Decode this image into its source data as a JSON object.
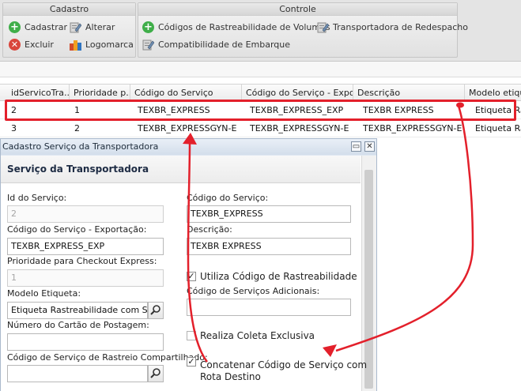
{
  "ribbon": {
    "cadastro": {
      "title": "Cadastro",
      "cadastrar": "Cadastrar",
      "alterar": "Alterar",
      "excluir": "Excluir",
      "logomarca": "Logomarca"
    },
    "controle": {
      "title": "Controle",
      "codigos_rastreabilidade": "Códigos de Rastreabilidade de Volumes",
      "transportadora_redespacho": "Transportadora de Redespacho",
      "compatibilidade_embarque": "Compatibilidade de Embarque"
    }
  },
  "grid": {
    "columns": [
      "idServicoTra...",
      "Prioridade p...",
      "Código do Serviço",
      "Código do Serviço - Expo...",
      "Descrição",
      "Modelo etique"
    ],
    "rows": [
      [
        "2",
        "1",
        "TEXBR_EXPRESS",
        "TEXBR_EXPRESS_EXP",
        "TEXBR EXPRESS",
        "Etiqueta Ras"
      ],
      [
        "3",
        "2",
        "TEXBR_EXPRESSGYN-E",
        "TEXBR_EXPRESSGYN-E",
        "TEXBR_EXPRESSGYN-E",
        "Etiqueta Ras"
      ]
    ]
  },
  "window": {
    "title": "Cadastro Serviço da Transportadora",
    "panel_title": "Serviço da Transportadora",
    "fields": {
      "id_label": "Id do Serviço:",
      "id_value": "2",
      "codigo_label": "Código do Serviço:",
      "codigo_value": "TEXBR_EXPRESS",
      "codigo_exp_label": "Código do Serviço - Exportação:",
      "codigo_exp_value": "TEXBR_EXPRESS_EXP",
      "descricao_label": "Descrição:",
      "descricao_value": "TEXBR EXPRESS",
      "prioridade_label": "Prioridade para Checkout Express:",
      "prioridade_value": "1",
      "utiliza_label": "Utiliza Código de Rastreabilidade",
      "modelo_label": "Modelo Etiqueta:",
      "modelo_value": "Etiqueta Rastreabilidade com Serv",
      "adicionais_label": "Código de Serviços Adicionais:",
      "adicionais_value": "",
      "cartao_label": "Número do Cartão de Postagem:",
      "cartao_value": "",
      "coleta_label": "Realiza Coleta Exclusiva",
      "compartilhado_label": "Código de Serviço de Rastreio Compartilhado:",
      "compartilhado_value": "",
      "concatenar_label_1": "Concatenar Código de Serviço com",
      "concatenar_label_2": "Rota Destino"
    },
    "checks": {
      "utiliza": true,
      "coleta": false,
      "concatenar": true
    }
  },
  "colors": {
    "annotation_red": "#e3202b",
    "add_green": "#3fae49",
    "delete_red": "#d9453b"
  },
  "icons": [
    "plus-circle-icon",
    "edit-pencil-icon",
    "delete-x-icon",
    "logo-image-icon",
    "search-icon",
    "minimize-icon",
    "close-icon"
  ]
}
